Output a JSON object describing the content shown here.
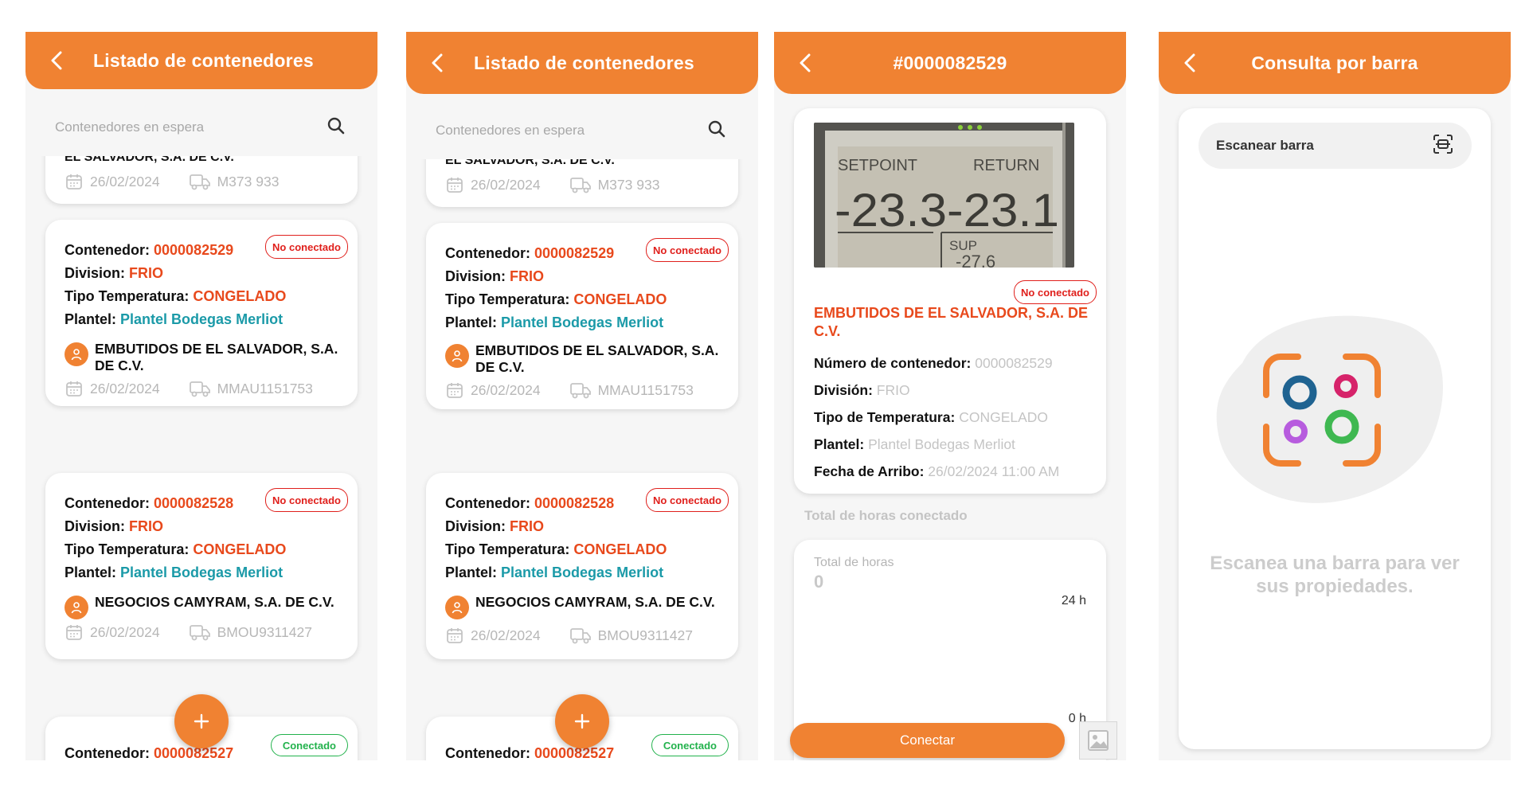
{
  "colors": {
    "accent": "#f08232",
    "red": "#e8491c",
    "teal": "#1b9aa8",
    "badge_red": "#e0201c",
    "badge_green": "#22b24c"
  },
  "screen1": {
    "title": "Listado de contenedores",
    "search_placeholder": "Contenedores en espera",
    "partial_top": {
      "client": "EL SALVADOR, S.A. DE C.V.",
      "date": "26/02/2024",
      "plate": "M373 933"
    },
    "cards": [
      {
        "label_container": "Contenedor:",
        "container": "0000082529",
        "status": "No conectado",
        "label_division": "Division:",
        "division": "FRIO",
        "label_temp": "Tipo Temperatura:",
        "temp": "CONGELADO",
        "label_plantel": "Plantel:",
        "plantel": "Plantel Bodegas Merliot",
        "client": "EMBUTIDOS DE EL SALVADOR, S.A. DE C.V.",
        "date": "26/02/2024",
        "plate": "MMAU1151753"
      },
      {
        "label_container": "Contenedor:",
        "container": "0000082528",
        "status": "No conectado",
        "label_division": "Division:",
        "division": "FRIO",
        "label_temp": "Tipo Temperatura:",
        "temp": "CONGELADO",
        "label_plantel": "Plantel:",
        "plantel": "Plantel Bodegas Merliot",
        "client": "NEGOCIOS CAMYRAM, S.A. DE C.V.",
        "date": "26/02/2024",
        "plate": "BMOU9311427"
      },
      {
        "label_container": "Contenedor:",
        "container": "0000082527",
        "status": "Conectado"
      }
    ],
    "fab": "+"
  },
  "screen2": {
    "title": "Listado de contenedores",
    "search_placeholder": "Contenedores en espera",
    "partial_top": {
      "client": "EL SALVADOR, S.A. DE C.V.",
      "date": "26/02/2024",
      "plate": "M373 933"
    },
    "cards": [
      {
        "label_container": "Contenedor:",
        "container": "0000082529",
        "status": "No conectado",
        "label_division": "Division:",
        "division": "FRIO",
        "label_temp": "Tipo Temperatura:",
        "temp": "CONGELADO",
        "label_plantel": "Plantel:",
        "plantel": "Plantel Bodegas Merliot",
        "client": "EMBUTIDOS DE EL SALVADOR, S.A. DE C.V.",
        "date": "26/02/2024",
        "plate": "MMAU1151753"
      },
      {
        "label_container": "Contenedor:",
        "container": "0000082528",
        "status": "No conectado",
        "label_division": "Division:",
        "division": "FRIO",
        "label_temp": "Tipo Temperatura:",
        "temp": "CONGELADO",
        "label_plantel": "Plantel:",
        "plantel": "Plantel Bodegas Merliot",
        "client": "NEGOCIOS CAMYRAM, S.A. DE C.V.",
        "date": "26/02/2024",
        "plate": "BMOU9311427"
      },
      {
        "label_container": "Contenedor:",
        "container": "0000082527",
        "status": "Conectado"
      }
    ],
    "fab": "+"
  },
  "screen3": {
    "title": "#0000082529",
    "photo_text": {
      "setpoint": "SETPOINT",
      "return": "RETURN",
      "reading": "-23.3-23.1",
      "sup": "SUP",
      "small": "-27.6"
    },
    "status": "No conectado",
    "client": "EMBUTIDOS DE EL SALVADOR, S.A. DE C.V.",
    "fields": [
      {
        "label": "Número de contenedor:",
        "value": "0000082529"
      },
      {
        "label": "División:",
        "value": "FRIO"
      },
      {
        "label": "Tipo de Temperatura:",
        "value": "CONGELADO"
      },
      {
        "label": "Plantel:",
        "value": "Plantel Bodegas Merliot"
      },
      {
        "label": "Fecha de Arribo:",
        "value": "26/02/2024 11:00 AM"
      }
    ],
    "section_title": "Total de horas conectado",
    "hours_label": "Total de horas",
    "hours_value": "0",
    "axis_top": "24 h",
    "axis_bottom": "0 h",
    "connect_button": "Conectar"
  },
  "screen4": {
    "title": "Consulta por barra",
    "scan_placeholder": "Escanear barra",
    "empty_message": "Escanea una barra para ver sus propiedades."
  }
}
